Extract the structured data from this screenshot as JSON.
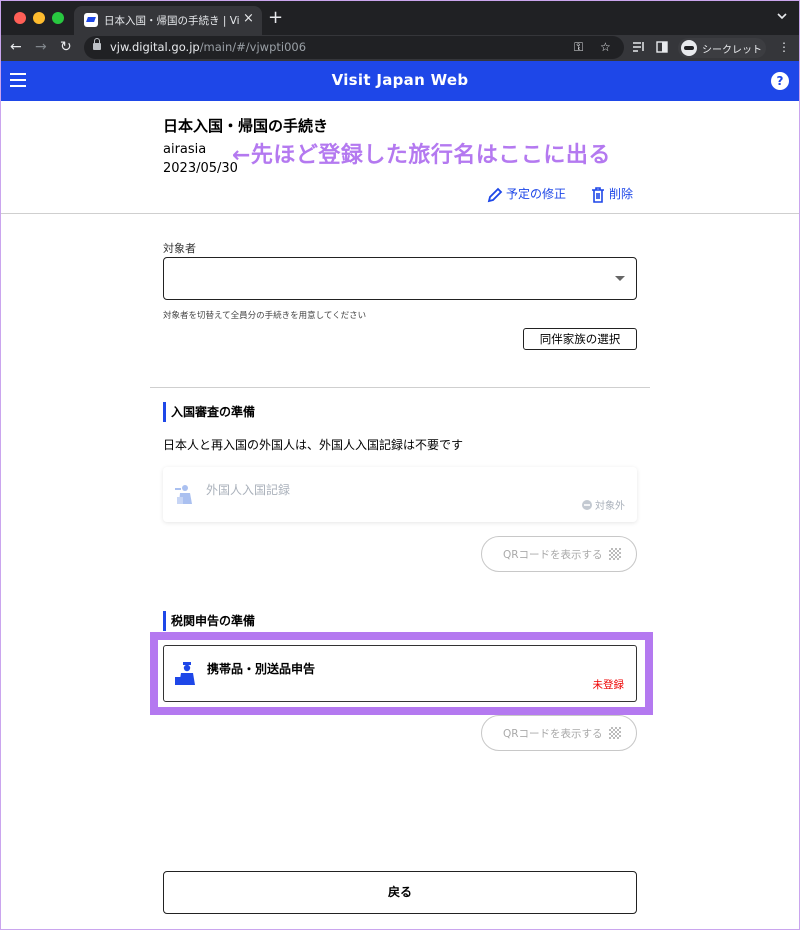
{
  "browser": {
    "tab_title": "日本入国・帰国の手続き | Visit Japan Web",
    "tab_close": "×",
    "new_tab": "+",
    "back": "←",
    "forward": "→",
    "reload": "↻",
    "url_host": "vjw.digital.go.jp",
    "url_path": "/main/#/vjwpti006",
    "key_icon": "⚿",
    "star_icon": "☆",
    "profile_label": "シークレット",
    "menu": "⋮"
  },
  "app": {
    "title": "Visit Japan Web",
    "help": "?"
  },
  "trip": {
    "heading": "日本入国・帰国の手続き",
    "name": "airasia",
    "date": "2023/05/30",
    "edit_label": "予定の修正",
    "delete_label": "削除"
  },
  "annotation": "←先ほど登録した旅行名はここに出る",
  "target": {
    "label": "対象者",
    "value": "",
    "helper": "対象者を切替えて全員分の手続きを用意してください",
    "family_button": "同伴家族の選択"
  },
  "immigration": {
    "heading": "入国審査の準備",
    "description": "日本人と再入国の外国人は、外国人入国記録は不要です",
    "card_label": "外国人入国記録",
    "card_status": "対象外",
    "qr_label": "QRコードを表示する"
  },
  "customs": {
    "heading": "税関申告の準備",
    "card_label": "携帯品・別送品申告",
    "card_status": "未登録",
    "qr_label": "QRコードを表示する"
  },
  "back_button": "戻る",
  "colors": {
    "brand_blue": "#1e47e8",
    "highlight_purple": "#b479f0",
    "status_red": "#ee0000"
  }
}
